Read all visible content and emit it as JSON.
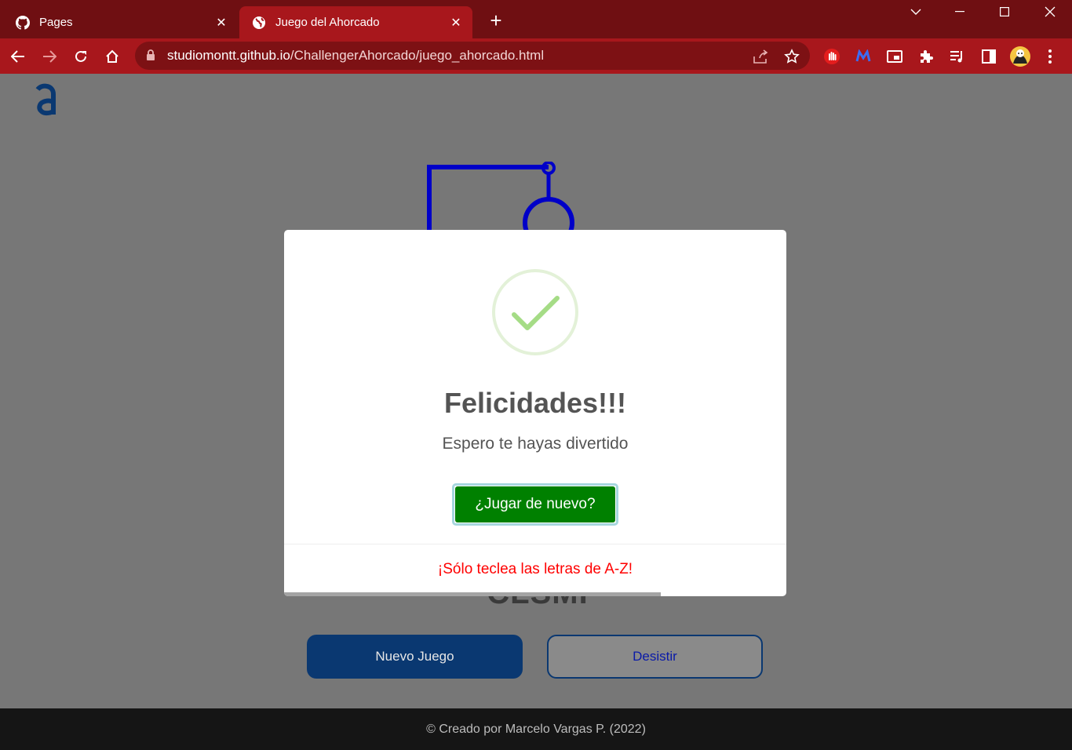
{
  "browser": {
    "tabs": [
      {
        "title": "Pages",
        "icon": "github-icon",
        "active": false
      },
      {
        "title": "Juego del Ahorcado",
        "icon": "globe-icon",
        "active": true
      }
    ],
    "url_host": "studiomontt.github.io",
    "url_path": "/ChallengerAhorcado/juego_ahorcado.html",
    "colors": {
      "tabbar": "#6f0f12",
      "toolbar": "#a8171c",
      "omnibox": "#7d1114"
    }
  },
  "page": {
    "logo": "a",
    "word_partial": "CLSMI",
    "buttons": {
      "new_game": "Nuevo Juego",
      "give_up": "Desistir"
    },
    "footer": "© Creado por Marcelo Vargas P. (2022)",
    "colors": {
      "primary": "#0a3871",
      "gallows": "#0000c8",
      "overlay": "#777777"
    }
  },
  "modal": {
    "icon": "success-check-icon",
    "title": "Felicidades!!!",
    "text": "Espero te hayas divertido",
    "confirm": "¿Jugar de nuevo?",
    "footer": "¡Sólo teclea las letras de A-Z!",
    "timer_progress": 0.75,
    "colors": {
      "confirm": "#008000",
      "footer_text": "#ff0000",
      "check": "#a5dc86"
    }
  }
}
